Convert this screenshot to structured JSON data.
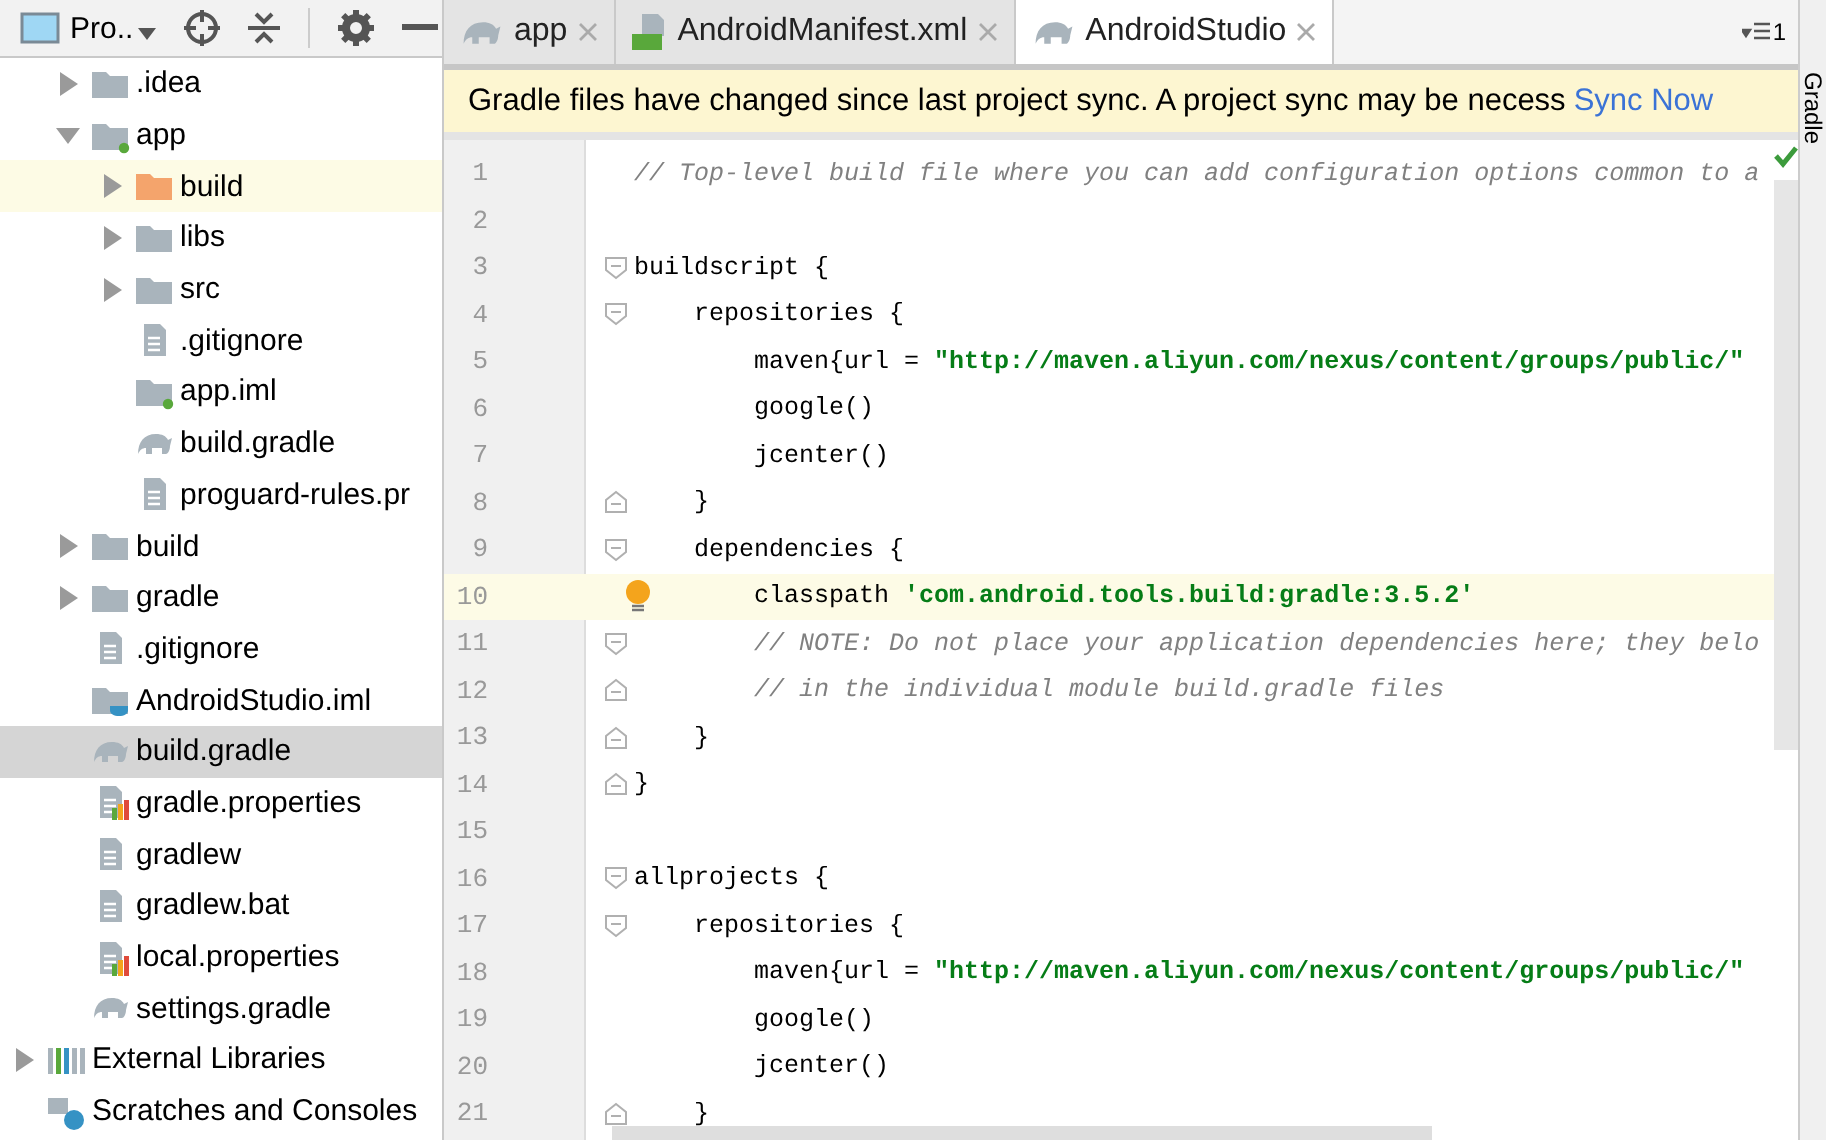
{
  "sidebar": {
    "title": "Pro..",
    "tree": {
      "project_children": [
        {
          "label": ".idea",
          "kind": "folder",
          "expanded": false,
          "selected": false,
          "highlighted": false
        },
        {
          "label": "app",
          "kind": "module",
          "expanded": true,
          "selected": false,
          "highlighted": false,
          "children": [
            {
              "label": "build",
              "kind": "excluded",
              "expanded": false,
              "selected": false,
              "highlighted": true
            },
            {
              "label": "libs",
              "kind": "folder",
              "expanded": false,
              "selected": false,
              "highlighted": false
            },
            {
              "label": "src",
              "kind": "folder",
              "expanded": false,
              "selected": false,
              "highlighted": false
            },
            {
              "label": ".gitignore",
              "kind": "file",
              "selected": false,
              "highlighted": false
            },
            {
              "label": "app.iml",
              "kind": "module",
              "selected": false,
              "highlighted": false
            },
            {
              "label": "build.gradle",
              "kind": "gradle",
              "selected": false,
              "highlighted": false
            },
            {
              "label": "proguard-rules.pr",
              "kind": "file",
              "selected": false,
              "highlighted": false
            }
          ]
        },
        {
          "label": "build",
          "kind": "folder",
          "expanded": false,
          "selected": false,
          "highlighted": false
        },
        {
          "label": "gradle",
          "kind": "folder",
          "expanded": false,
          "selected": false,
          "highlighted": false
        },
        {
          "label": ".gitignore",
          "kind": "file",
          "selected": false,
          "highlighted": false
        },
        {
          "label": "AndroidStudio.iml",
          "kind": "project",
          "selected": false,
          "highlighted": false
        },
        {
          "label": "build.gradle",
          "kind": "gradle",
          "selected": true,
          "highlighted": false
        },
        {
          "label": "gradle.properties",
          "kind": "properties",
          "selected": false,
          "highlighted": false
        },
        {
          "label": "gradlew",
          "kind": "file",
          "selected": false,
          "highlighted": false
        },
        {
          "label": "gradlew.bat",
          "kind": "file",
          "selected": false,
          "highlighted": false
        },
        {
          "label": "local.properties",
          "kind": "properties",
          "selected": false,
          "highlighted": false
        },
        {
          "label": "settings.gradle",
          "kind": "gradle",
          "selected": false,
          "highlighted": false
        }
      ],
      "roots": [
        {
          "label": "External Libraries",
          "kind": "libraries",
          "expanded": false,
          "selected": false,
          "highlighted": false
        },
        {
          "label": "Scratches and Consoles",
          "kind": "scratches",
          "selected": false,
          "highlighted": false
        }
      ]
    }
  },
  "tabs": [
    {
      "label": "app",
      "kind": "gradle",
      "selected": false
    },
    {
      "label": "AndroidManifest.xml",
      "kind": "manifest",
      "selected": false
    },
    {
      "label": "AndroidStudio",
      "kind": "gradle",
      "selected": true
    }
  ],
  "hidden_tab_count": "1",
  "banner": {
    "message": "Gradle files have changed since last project sync. A project sync may be necess",
    "link": "Sync Now"
  },
  "editor": {
    "lines": [
      {
        "number": "1",
        "kind": "plain",
        "current": false,
        "segments": [
          {
            "kind": "comment",
            "text": "// Top-level build file where you can add configuration options common to a"
          }
        ]
      },
      {
        "number": "2",
        "kind": "plain",
        "current": false
      },
      {
        "number": "3",
        "kind": "fold-start",
        "current": false,
        "segments": [
          {
            "kind": "plain",
            "text": "buildscript {"
          }
        ]
      },
      {
        "number": "4",
        "kind": "fold-start",
        "current": false,
        "segments": [
          {
            "kind": "plain",
            "text": "    repositories {"
          }
        ]
      },
      {
        "number": "5",
        "kind": "plain",
        "current": false,
        "segments": [
          {
            "kind": "plain",
            "text": "        maven{url = "
          },
          {
            "kind": "string",
            "text": "\"http://maven.aliyun.com/nexus/content/groups/public/\""
          }
        ]
      },
      {
        "number": "6",
        "kind": "plain",
        "current": false,
        "segments": [
          {
            "kind": "plain",
            "text": "        google()"
          }
        ]
      },
      {
        "number": "7",
        "kind": "plain",
        "current": false,
        "segments": [
          {
            "kind": "plain",
            "text": "        jcenter()"
          }
        ]
      },
      {
        "number": "8",
        "kind": "fold-end",
        "current": false,
        "segments": [
          {
            "kind": "plain",
            "text": "    }"
          }
        ]
      },
      {
        "number": "9",
        "kind": "fold-start",
        "current": false,
        "segments": [
          {
            "kind": "plain",
            "text": "    dependencies {"
          }
        ]
      },
      {
        "number": "10",
        "kind": "bulb",
        "current": true,
        "segments": [
          {
            "kind": "plain",
            "text": "        classpath "
          },
          {
            "kind": "string",
            "text": "'com.android.tools.build:gradle:3.5.2'"
          }
        ]
      },
      {
        "number": "11",
        "kind": "fold-start",
        "current": false,
        "segments": [
          {
            "kind": "comment",
            "text": "        // NOTE: Do not place your application dependencies here; they belo"
          }
        ]
      },
      {
        "number": "12",
        "kind": "fold-end",
        "current": false,
        "segments": [
          {
            "kind": "comment",
            "text": "        // in the individual module build.gradle files"
          }
        ]
      },
      {
        "number": "13",
        "kind": "fold-end",
        "current": false,
        "segments": [
          {
            "kind": "plain",
            "text": "    }"
          }
        ]
      },
      {
        "number": "14",
        "kind": "fold-end",
        "current": false,
        "segments": [
          {
            "kind": "plain",
            "text": "}"
          }
        ]
      },
      {
        "number": "15",
        "kind": "plain",
        "current": false
      },
      {
        "number": "16",
        "kind": "fold-start",
        "current": false,
        "segments": [
          {
            "kind": "plain",
            "text": "allprojects {"
          }
        ]
      },
      {
        "number": "17",
        "kind": "fold-start",
        "current": false,
        "segments": [
          {
            "kind": "plain",
            "text": "    repositories {"
          }
        ]
      },
      {
        "number": "18",
        "kind": "plain",
        "current": false,
        "segments": [
          {
            "kind": "plain",
            "text": "        maven{url = "
          },
          {
            "kind": "string",
            "text": "\"http://maven.aliyun.com/nexus/content/groups/public/\""
          }
        ]
      },
      {
        "number": "19",
        "kind": "plain",
        "current": false,
        "segments": [
          {
            "kind": "plain",
            "text": "        google()"
          }
        ]
      },
      {
        "number": "20",
        "kind": "plain",
        "current": false,
        "segments": [
          {
            "kind": "plain",
            "text": "        jcenter()"
          }
        ]
      },
      {
        "number": "21",
        "kind": "fold-end",
        "current": false,
        "segments": [
          {
            "kind": "plain",
            "text": "    }"
          }
        ]
      }
    ]
  },
  "right_strip": {
    "label": "Gradle"
  }
}
